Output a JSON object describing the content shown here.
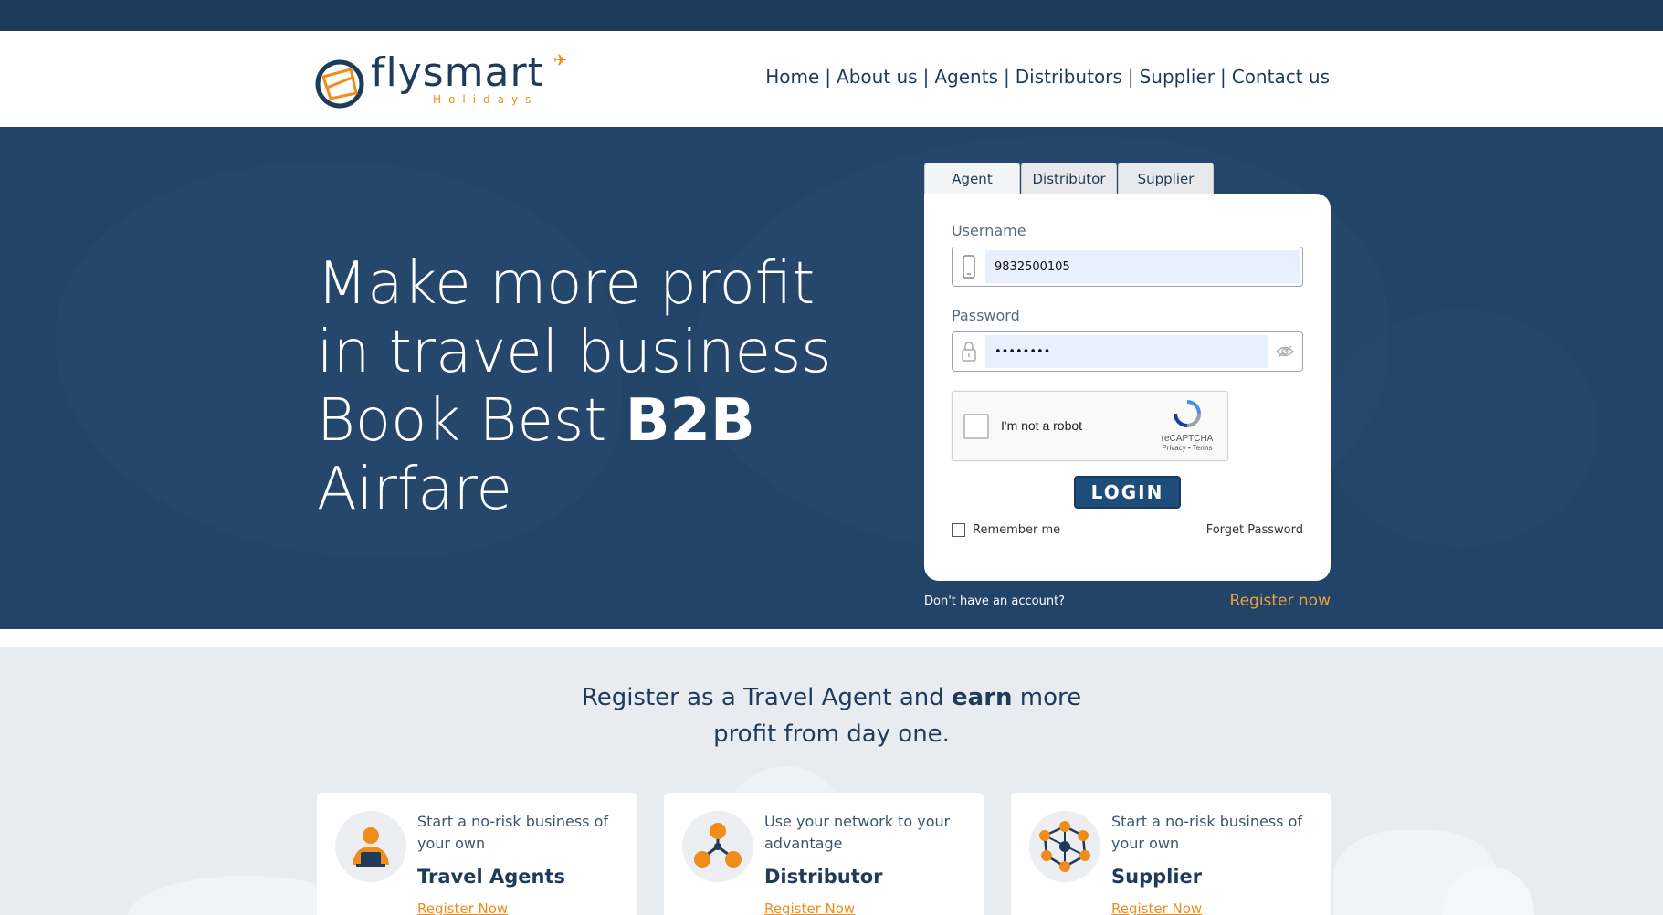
{
  "colors": {
    "brand": "#1f3b5c",
    "accent": "#f08c1b",
    "hero_bg": "#224469",
    "autofill": "#e8f0fe"
  },
  "header": {
    "logo_word": "flysmart",
    "logo_sub": "Holidays",
    "nav": [
      "Home",
      "About us",
      "Agents",
      "Distributors",
      "Supplier",
      "Contact us"
    ],
    "separator": "|"
  },
  "hero": {
    "line1": "Make more profit",
    "line2": "in travel business",
    "line3_prefix": "Book Best ",
    "line3_bold": "B2B",
    "line4": "Airfare"
  },
  "login": {
    "tabs": [
      "Agent",
      "Distributor",
      "Supplier"
    ],
    "username_label": "Username",
    "username_value": "9832500105",
    "password_label": "Password",
    "password_value": "••••••••",
    "captcha_text": "I'm not a robot",
    "captcha_brand": "reCAPTCHA",
    "captcha_links": "Privacy • Terms",
    "login_button": "LOGIN",
    "remember_me": "Remember me",
    "forget_password": "Forget Password",
    "no_account": "Don't have an account?",
    "register_now": "Register now",
    "icons": {
      "username": "phone-icon",
      "password": "lock-icon",
      "toggle": "eye-icon"
    }
  },
  "register_section": {
    "line1_prefix": "Register as a Travel Agent and ",
    "line1_bold": "earn",
    "line1_suffix": " more",
    "line2": "profit from day one.",
    "cards": [
      {
        "icon": "agent-icon",
        "description": "Start a no-risk business of your own",
        "title": "Travel Agents",
        "link": "Register Now"
      },
      {
        "icon": "network-icon",
        "description": "Use your network to your advantage",
        "title": "Distributor",
        "link": "Register Now"
      },
      {
        "icon": "supplier-network-icon",
        "description": "Start a no-risk business of your own",
        "title": "Supplier",
        "link": "Register Now"
      }
    ]
  }
}
